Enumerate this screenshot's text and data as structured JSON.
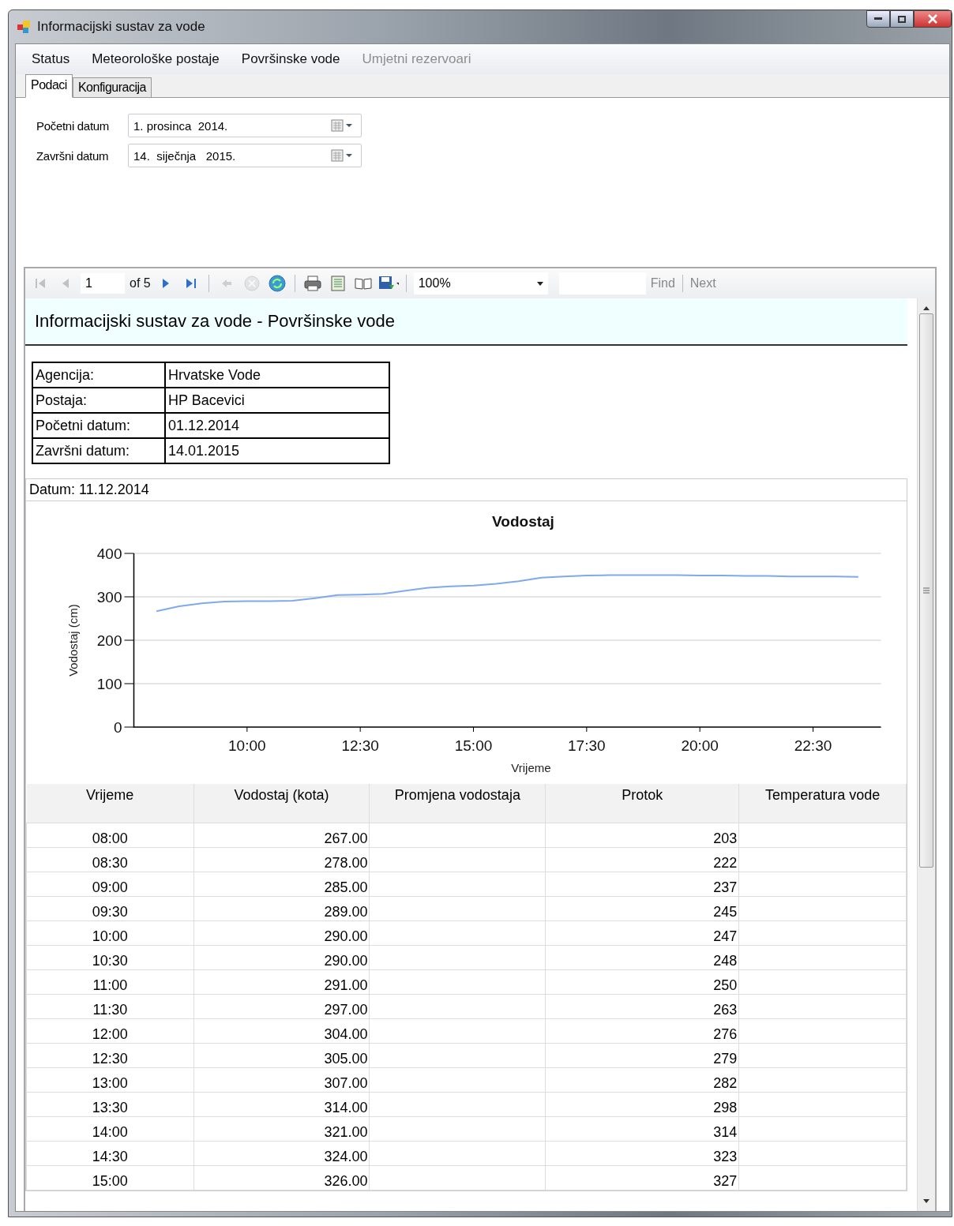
{
  "window": {
    "title": "Informacijski sustav za vode"
  },
  "menu": [
    {
      "label": "Status",
      "disabled": false
    },
    {
      "label": "Meteorološke postaje",
      "disabled": false
    },
    {
      "label": "Površinske vode",
      "disabled": false
    },
    {
      "label": "Umjetni rezervoari",
      "disabled": true
    }
  ],
  "tabs": [
    {
      "label": "Podaci",
      "selected": true
    },
    {
      "label": "Konfiguracija",
      "selected": false
    }
  ],
  "fields": [
    {
      "label": "Početni datum",
      "value": "1. prosinca  2014."
    },
    {
      "label": "Završni datum",
      "value": "14.  siječnja   2015."
    }
  ],
  "toolbar": {
    "buttons": [
      {
        "kind": "first",
        "disabled": true
      },
      {
        "kind": "prev",
        "disabled": true
      },
      {
        "kind": "page"
      },
      {
        "kind": "next",
        "disabled": false
      },
      {
        "kind": "last",
        "disabled": false
      },
      {
        "kind": "sep"
      },
      {
        "kind": "back",
        "disabled": true
      },
      {
        "kind": "stop",
        "disabled": true
      },
      {
        "kind": "refresh",
        "disabled": false
      },
      {
        "kind": "sep"
      },
      {
        "kind": "print",
        "disabled": false
      },
      {
        "kind": "layout",
        "disabled": false
      },
      {
        "kind": "setup",
        "disabled": false
      },
      {
        "kind": "export",
        "disabled": false
      },
      {
        "kind": "sep"
      }
    ],
    "page": "1",
    "page_count": "of 5",
    "zoom": "100%",
    "find": "Find",
    "next": "Next"
  },
  "report": {
    "title": "Informacijski sustav za vode - Površinske vode",
    "info": [
      {
        "label": "Agencija:",
        "value": "Hrvatske Vode"
      },
      {
        "label": "Postaja:",
        "value": "HP Bacevici"
      },
      {
        "label": "Početni datum:",
        "value": "01.12.2014"
      },
      {
        "label": "Završni datum:",
        "value": "14.01.2015"
      }
    ],
    "date": "Datum: 11.12.2014",
    "chart_data": {
      "type": "line",
      "title": "Vodostaj",
      "xlabel": "Vrijeme",
      "ylabel": "Vodostaj (cm)",
      "x": [
        8,
        8.5,
        9,
        9.5,
        10,
        10.5,
        11,
        11.5,
        12,
        12.5,
        13,
        13.5,
        14,
        14.5,
        15,
        15.5,
        16,
        16.5,
        17,
        17.5,
        18,
        18.5,
        19,
        19.5,
        20,
        20.5,
        21,
        21.5,
        22,
        22.5,
        23,
        23.5
      ],
      "grid": true,
      "series": [
        {
          "color": "#7fa9ef",
          "values": [
            267,
            278,
            285,
            289,
            290,
            290,
            291,
            297,
            304,
            305,
            307,
            314,
            321,
            324,
            326,
            330,
            336,
            344,
            347,
            349,
            350,
            350,
            350,
            350,
            349,
            349,
            348,
            348,
            347,
            347,
            347,
            346
          ]
        }
      ],
      "xlim": [
        7.5,
        24
      ],
      "ylim": [
        0,
        400
      ],
      "xticks": [
        {
          "value": 10,
          "label": "10:00"
        },
        {
          "value": 12.5,
          "label": "12:30"
        },
        {
          "value": 15,
          "label": "15:00"
        },
        {
          "value": 17.5,
          "label": "17:30"
        },
        {
          "value": 20,
          "label": "20:00"
        },
        {
          "value": 22.5,
          "label": "22:30"
        }
      ],
      "yticks": [
        0,
        100,
        200,
        300,
        400
      ]
    },
    "table": {
      "columns": [
        "Vrijeme",
        "Vodostaj (kota)",
        "Promjena vodostaja",
        "Protok",
        "Temperatura vode"
      ],
      "rows": [
        [
          "08:00",
          "267.00",
          "",
          "203",
          ""
        ],
        [
          "08:30",
          "278.00",
          "",
          "222",
          ""
        ],
        [
          "09:00",
          "285.00",
          "",
          "237",
          ""
        ],
        [
          "09:30",
          "289.00",
          "",
          "245",
          ""
        ],
        [
          "10:00",
          "290.00",
          "",
          "247",
          ""
        ],
        [
          "10:30",
          "290.00",
          "",
          "248",
          ""
        ],
        [
          "11:00",
          "291.00",
          "",
          "250",
          ""
        ],
        [
          "11:30",
          "297.00",
          "",
          "263",
          ""
        ],
        [
          "12:00",
          "304.00",
          "",
          "276",
          ""
        ],
        [
          "12:30",
          "305.00",
          "",
          "279",
          ""
        ],
        [
          "13:00",
          "307.00",
          "",
          "282",
          ""
        ],
        [
          "13:30",
          "314.00",
          "",
          "298",
          ""
        ],
        [
          "14:00",
          "321.00",
          "",
          "314",
          ""
        ],
        [
          "14:30",
          "324.00",
          "",
          "323",
          ""
        ],
        [
          "15:00",
          "326.00",
          "",
          "327",
          ""
        ]
      ]
    }
  }
}
